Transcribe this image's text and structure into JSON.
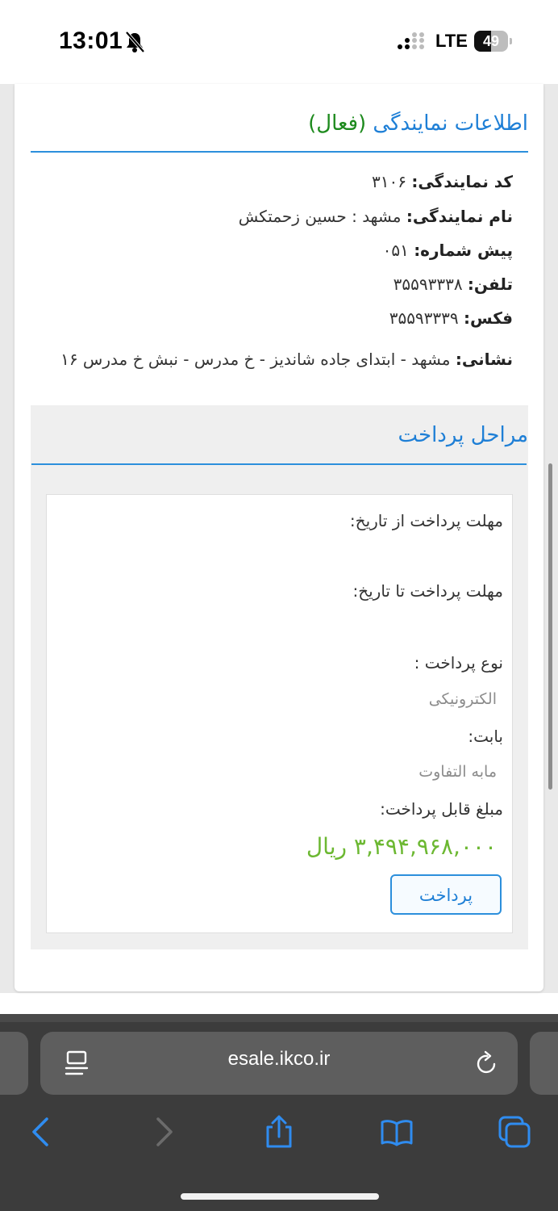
{
  "status_bar": {
    "time": "13:01",
    "network": "LTE",
    "battery": "49",
    "battery_level": 0.49
  },
  "agency": {
    "title": "اطلاعات نمایندگی",
    "status": "(فعال)",
    "fields": [
      {
        "label": "کد نمایندگی:",
        "value": "۳۱۰۶"
      },
      {
        "label": "نام نمایندگی:",
        "value": "مشهد : حسین زحمتکش"
      },
      {
        "label": "پیش شماره:",
        "value": "۰۵۱"
      },
      {
        "label": "تلفن:",
        "value": "۳۵۵۹۳۳۳۸"
      },
      {
        "label": "فکس:",
        "value": "۳۵۵۹۳۳۳۹"
      },
      {
        "label": "نشانی:",
        "value": "مشهد - ابتدای جاده شاندیز - خ مدرس - نبش خ مدرس ۱۶"
      }
    ]
  },
  "payment": {
    "title": "مراحل پرداخت",
    "deadline_from_label": "مهلت پرداخت از تاریخ:",
    "deadline_to_label": "مهلت پرداخت تا تاریخ:",
    "type_label": "نوع پرداخت :",
    "type_value": "الکترونیکی",
    "reason_label": "بابت:",
    "reason_value": "مابه التفاوت",
    "amount_label": "مبلغ قابل پرداخت:",
    "amount_value": "۳,۴۹۴,۹۶۸,۰۰۰ ریال",
    "pay_button": "پرداخت"
  },
  "browser": {
    "url": "esale.ikco.ir"
  }
}
